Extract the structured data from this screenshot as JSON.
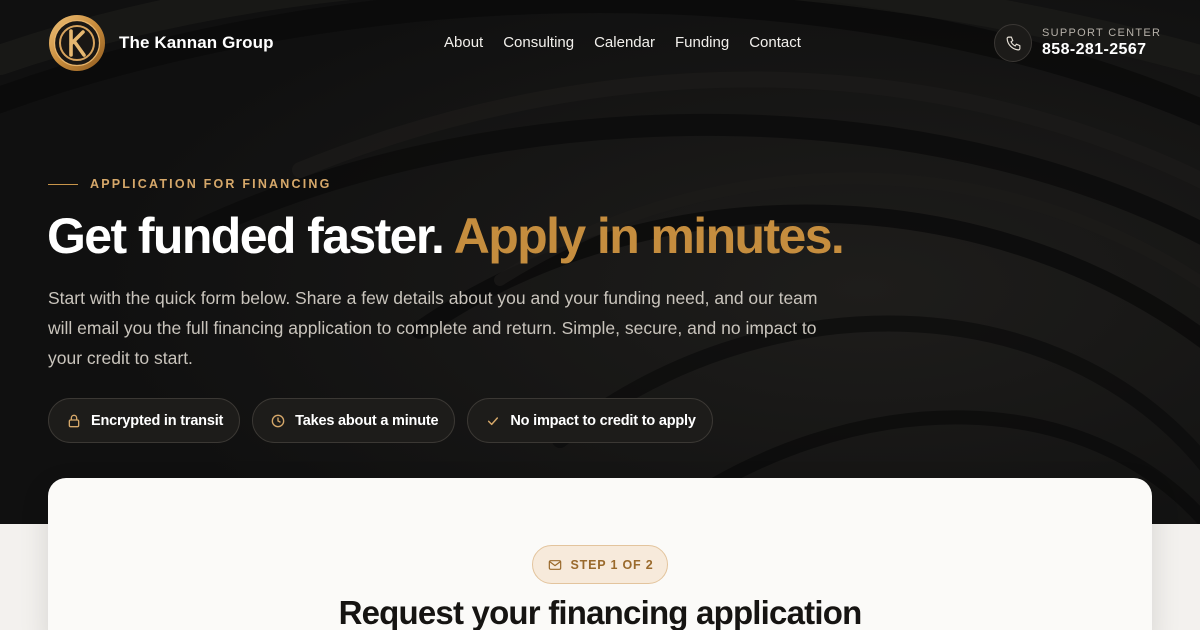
{
  "header": {
    "brand_name": "The Kannan Group",
    "nav": [
      {
        "label": "About"
      },
      {
        "label": "Consulting"
      },
      {
        "label": "Calendar"
      },
      {
        "label": "Funding"
      },
      {
        "label": "Contact"
      }
    ],
    "support_label": "SUPPORT CENTER",
    "support_phone": "858-281-2567",
    "phone_icon": "phone-icon"
  },
  "hero": {
    "eyebrow": "APPLICATION FOR FINANCING",
    "headline_white": "Get funded faster.",
    "headline_gold": "Apply in minutes.",
    "lead": "Start with the quick form below. Share a few details about you and your funding need, and our team will email you the full financing application to complete and return. Simple, secure, and no impact to your credit to start.",
    "badges": [
      {
        "icon": "lock-icon",
        "label": "Encrypted in transit"
      },
      {
        "icon": "clock-icon",
        "label": "Takes about a minute"
      },
      {
        "icon": "check-icon",
        "label": "No impact to credit to apply"
      }
    ]
  },
  "form_card": {
    "step_icon": "mail-icon",
    "step_label": "STEP 1 OF 2",
    "title": "Request your financing application"
  },
  "colors": {
    "hero_bg": "#121110",
    "accent_gold": "#c58d3e",
    "eyebrow_gold": "#d6a86a",
    "card_bg": "#fbfaf8",
    "page_bg": "#f3f1ee"
  }
}
